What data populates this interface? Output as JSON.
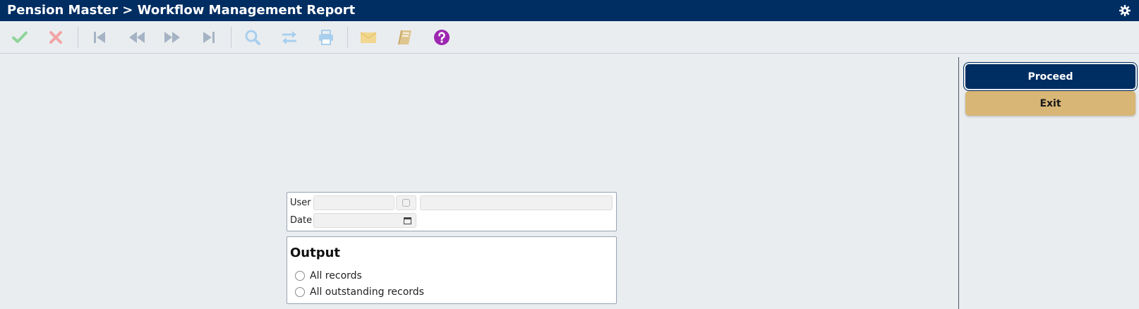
{
  "header": {
    "title": "Pension Master > Workflow Management Report",
    "settings_icon": "gear-icon"
  },
  "toolbar": {
    "icons": [
      "check-icon",
      "cancel-icon",
      "first-record-icon",
      "previous-record-icon",
      "next-record-icon",
      "last-record-icon",
      "search-icon",
      "swap-icon",
      "print-icon",
      "mail-icon",
      "book-icon",
      "help-icon"
    ]
  },
  "actions": {
    "proceed_label": "Proceed",
    "exit_label": "Exit"
  },
  "form": {
    "user_label": "User",
    "user_value": "",
    "user_name_value": "",
    "date_label": "Date",
    "date_value": ""
  },
  "output": {
    "title": "Output",
    "options": [
      {
        "label": "All records",
        "selected": false
      },
      {
        "label": "All outstanding records",
        "selected": false
      }
    ]
  },
  "colors": {
    "header_bg": "#002d62",
    "proceed_bg": "#002d62",
    "exit_bg": "#d8b675",
    "page_bg": "#eaedf0",
    "help_purple": "#9c27b0"
  }
}
